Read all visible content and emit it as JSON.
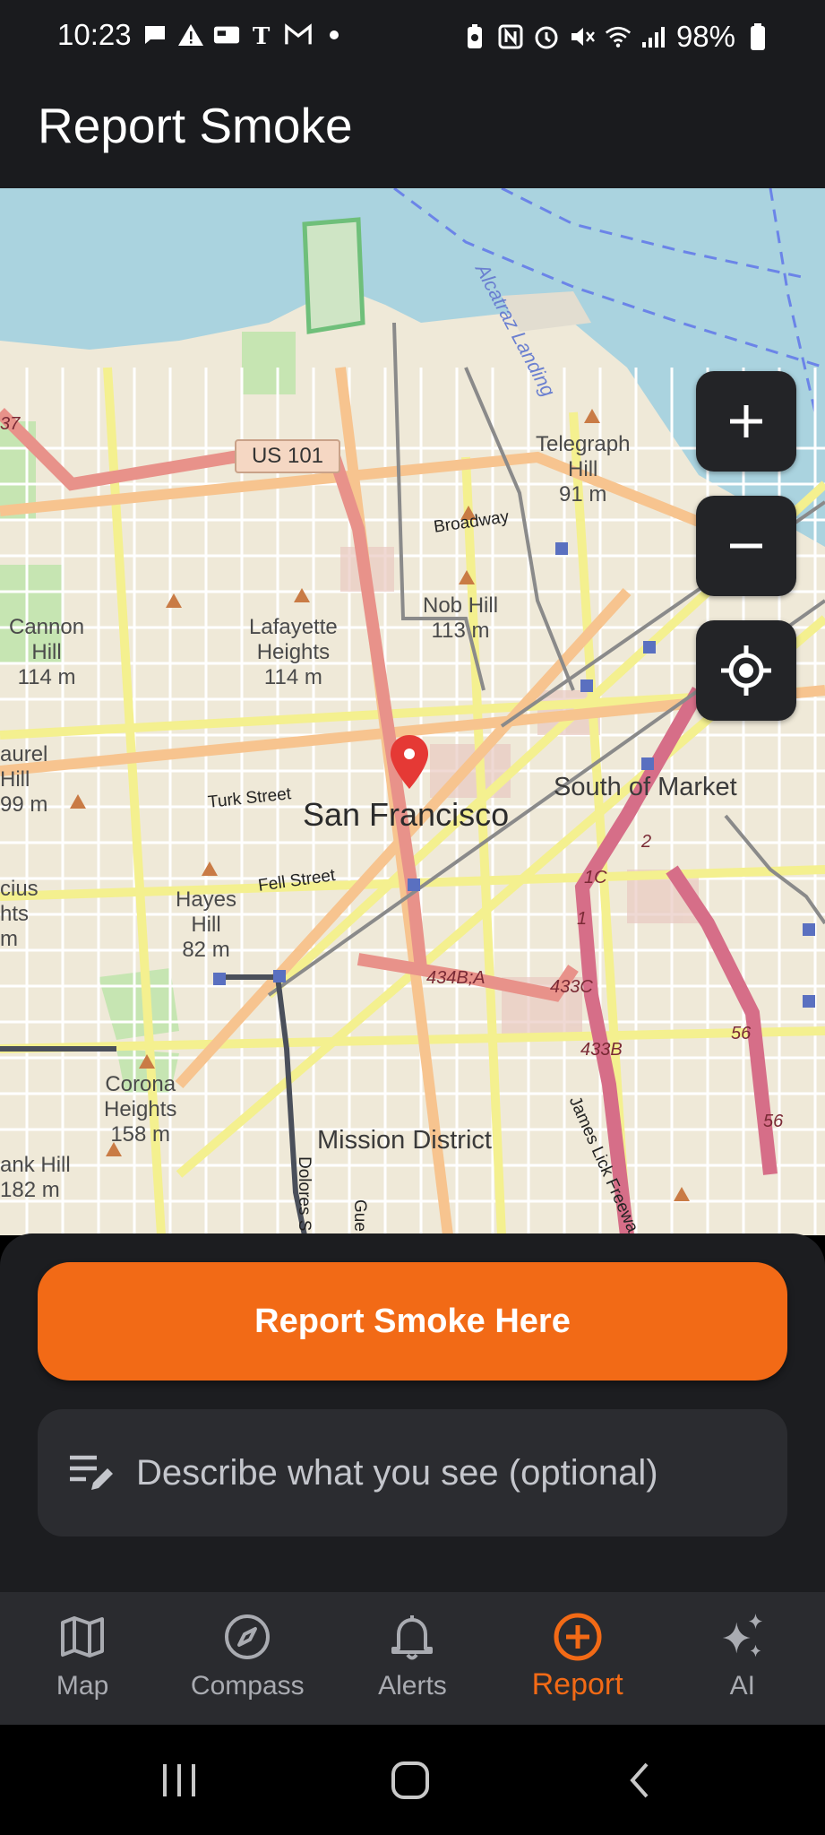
{
  "status_bar": {
    "time": "10:23",
    "battery_percent": "98%",
    "left_icons": [
      "chat-icon",
      "warning-icon",
      "card-icon",
      "nyt-icon",
      "gmail-icon",
      "dot-icon"
    ],
    "right_icons": [
      "battery-saver-icon",
      "nfc-icon",
      "alarm-icon",
      "mute-icon",
      "wifi-icon",
      "signal-icon",
      "battery-icon"
    ]
  },
  "app_bar": {
    "title": "Report Smoke"
  },
  "map": {
    "city_label": "San Francisco",
    "districts": [
      "South of Market",
      "Mission District"
    ],
    "hills": {
      "telegraph": "Telegraph\nHill\n91 m",
      "nob": "Nob Hill\n113 m",
      "cannon": "Cannon\nHill\n114 m",
      "lafayette": "Lafayette\nHeights\n114 m",
      "laurel": "aurel\nHill\n99 m",
      "hayes": "Hayes\nHill\n82 m",
      "corona": "Corona\nHeights\n158 m",
      "tank": "ank Hill\n182 m",
      "edge_left": "cius\nhts\nm"
    },
    "streets": {
      "broadway": "Broadway",
      "turk": "Turk Street",
      "fell": "Fell Street",
      "dolores": "Dolores S",
      "guerrero": "Gue",
      "james_lick": "James Lick Freewa"
    },
    "route_labels": {
      "us101": "US 101",
      "r434a": "434B;A",
      "r433c": "433C",
      "r433b": "433B",
      "r2": "2",
      "r1c": "1C",
      "r1": "1",
      "r56a": "56",
      "r56b": "56",
      "r37": "37"
    },
    "water_label": "Alcatraz Landing",
    "zoom_in": "+",
    "zoom_out": "−"
  },
  "sheet": {
    "report_button": "Report Smoke Here",
    "description_placeholder": "Describe what you see (optional)"
  },
  "bottom_nav": {
    "items": [
      {
        "label": "Map",
        "icon": "map-icon",
        "active": false
      },
      {
        "label": "Compass",
        "icon": "compass-icon",
        "active": false
      },
      {
        "label": "Alerts",
        "icon": "bell-icon",
        "active": false
      },
      {
        "label": "Report",
        "icon": "add-circle-icon",
        "active": true
      },
      {
        "label": "AI",
        "icon": "sparkle-icon",
        "active": false
      }
    ]
  },
  "colors": {
    "accent": "#f26a16",
    "surface": "#1c1d20",
    "nav_background": "#2a2b2f"
  }
}
